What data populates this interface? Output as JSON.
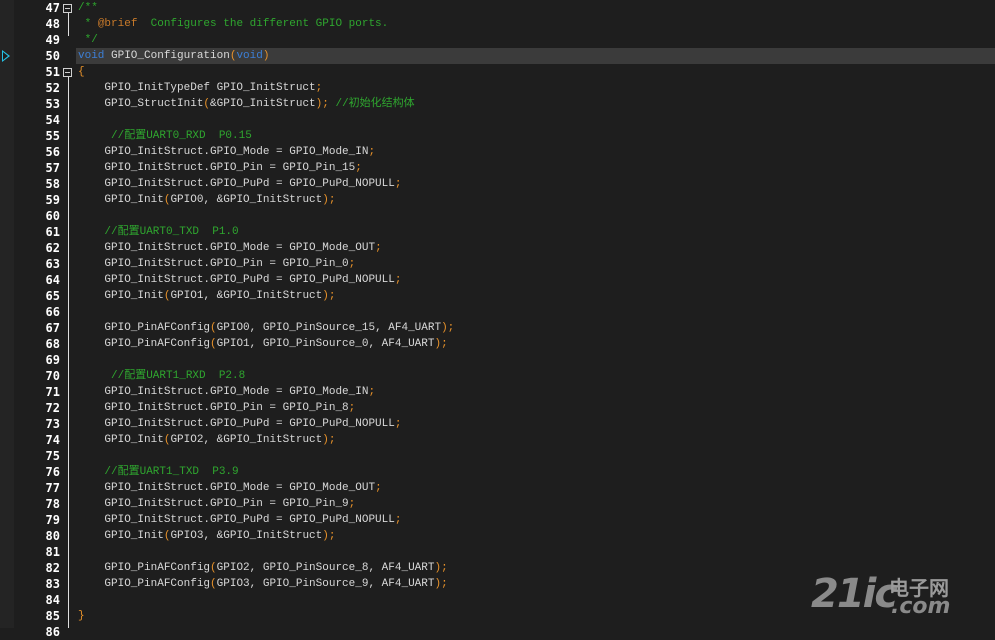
{
  "editor": {
    "current_line": "50",
    "lines": [
      {
        "n": "47",
        "tokens": [
          {
            "c": "t-doc",
            "t": "/**"
          }
        ],
        "fold": true
      },
      {
        "n": "48",
        "tokens": [
          {
            "c": "t-doc",
            "t": " * "
          },
          {
            "c": "t-tag",
            "t": "@brief"
          },
          {
            "c": "t-doc",
            "t": "  Configures the different GPIO ports."
          }
        ]
      },
      {
        "n": "49",
        "tokens": [
          {
            "c": "t-doc",
            "t": " */"
          }
        ]
      },
      {
        "n": "50",
        "tokens": [
          {
            "c": "t-kw",
            "t": "void"
          },
          {
            "c": "t-plain",
            "t": " GPIO_Configuration"
          },
          {
            "c": "t-brace",
            "t": "("
          },
          {
            "c": "t-kw",
            "t": "void"
          },
          {
            "c": "t-brace",
            "t": ")"
          }
        ],
        "current": true
      },
      {
        "n": "51",
        "tokens": [
          {
            "c": "t-brace",
            "t": "{"
          }
        ],
        "fold": true
      },
      {
        "n": "52",
        "tokens": [
          {
            "c": "t-plain",
            "t": "    GPIO_InitTypeDef GPIO_InitStruct"
          },
          {
            "c": "t-brace",
            "t": ";"
          }
        ]
      },
      {
        "n": "53",
        "tokens": [
          {
            "c": "t-plain",
            "t": "    GPIO_StructInit"
          },
          {
            "c": "t-brace",
            "t": "("
          },
          {
            "c": "t-plain",
            "t": "&GPIO_InitStruct"
          },
          {
            "c": "t-brace",
            "t": "); "
          },
          {
            "c": "t-comment",
            "t": "//初始化结构体"
          }
        ]
      },
      {
        "n": "54",
        "tokens": [
          {
            "c": "t-plain",
            "t": ""
          }
        ]
      },
      {
        "n": "55",
        "tokens": [
          {
            "c": "t-comment",
            "t": "     //配置UART0_RXD  P0.15"
          }
        ]
      },
      {
        "n": "56",
        "tokens": [
          {
            "c": "t-plain",
            "t": "    GPIO_InitStruct.GPIO_Mode = GPIO_Mode_IN"
          },
          {
            "c": "t-brace",
            "t": ";"
          }
        ]
      },
      {
        "n": "57",
        "tokens": [
          {
            "c": "t-plain",
            "t": "    GPIO_InitStruct.GPIO_Pin = GPIO_Pin_15"
          },
          {
            "c": "t-brace",
            "t": ";"
          }
        ]
      },
      {
        "n": "58",
        "tokens": [
          {
            "c": "t-plain",
            "t": "    GPIO_InitStruct.GPIO_PuPd = GPIO_PuPd_NOPULL"
          },
          {
            "c": "t-brace",
            "t": ";"
          }
        ]
      },
      {
        "n": "59",
        "tokens": [
          {
            "c": "t-plain",
            "t": "    GPIO_Init"
          },
          {
            "c": "t-brace",
            "t": "("
          },
          {
            "c": "t-plain",
            "t": "GPIO0, &GPIO_InitStruct"
          },
          {
            "c": "t-brace",
            "t": ");"
          }
        ]
      },
      {
        "n": "60",
        "tokens": [
          {
            "c": "t-plain",
            "t": ""
          }
        ]
      },
      {
        "n": "61",
        "tokens": [
          {
            "c": "t-comment",
            "t": "    //配置UART0_TXD  P1.0"
          }
        ]
      },
      {
        "n": "62",
        "tokens": [
          {
            "c": "t-plain",
            "t": "    GPIO_InitStruct.GPIO_Mode = GPIO_Mode_OUT"
          },
          {
            "c": "t-brace",
            "t": ";"
          }
        ]
      },
      {
        "n": "63",
        "tokens": [
          {
            "c": "t-plain",
            "t": "    GPIO_InitStruct.GPIO_Pin = GPIO_Pin_0"
          },
          {
            "c": "t-brace",
            "t": ";"
          }
        ]
      },
      {
        "n": "64",
        "tokens": [
          {
            "c": "t-plain",
            "t": "    GPIO_InitStruct.GPIO_PuPd = GPIO_PuPd_NOPULL"
          },
          {
            "c": "t-brace",
            "t": ";"
          }
        ]
      },
      {
        "n": "65",
        "tokens": [
          {
            "c": "t-plain",
            "t": "    GPIO_Init"
          },
          {
            "c": "t-brace",
            "t": "("
          },
          {
            "c": "t-plain",
            "t": "GPIO1, &GPIO_InitStruct"
          },
          {
            "c": "t-brace",
            "t": ");"
          }
        ]
      },
      {
        "n": "66",
        "tokens": [
          {
            "c": "t-plain",
            "t": ""
          }
        ]
      },
      {
        "n": "67",
        "tokens": [
          {
            "c": "t-plain",
            "t": "    GPIO_PinAFConfig"
          },
          {
            "c": "t-brace",
            "t": "("
          },
          {
            "c": "t-plain",
            "t": "GPIO0, GPIO_PinSource_15, AF4_UART"
          },
          {
            "c": "t-brace",
            "t": ");"
          }
        ]
      },
      {
        "n": "68",
        "tokens": [
          {
            "c": "t-plain",
            "t": "    GPIO_PinAFConfig"
          },
          {
            "c": "t-brace",
            "t": "("
          },
          {
            "c": "t-plain",
            "t": "GPIO1, GPIO_PinSource_0, AF4_UART"
          },
          {
            "c": "t-brace",
            "t": ");"
          }
        ]
      },
      {
        "n": "69",
        "tokens": [
          {
            "c": "t-plain",
            "t": ""
          }
        ]
      },
      {
        "n": "70",
        "tokens": [
          {
            "c": "t-comment",
            "t": "     //配置UART1_RXD  P2.8"
          }
        ]
      },
      {
        "n": "71",
        "tokens": [
          {
            "c": "t-plain",
            "t": "    GPIO_InitStruct.GPIO_Mode = GPIO_Mode_IN"
          },
          {
            "c": "t-brace",
            "t": ";"
          }
        ]
      },
      {
        "n": "72",
        "tokens": [
          {
            "c": "t-plain",
            "t": "    GPIO_InitStruct.GPIO_Pin = GPIO_Pin_8"
          },
          {
            "c": "t-brace",
            "t": ";"
          }
        ]
      },
      {
        "n": "73",
        "tokens": [
          {
            "c": "t-plain",
            "t": "    GPIO_InitStruct.GPIO_PuPd = GPIO_PuPd_NOPULL"
          },
          {
            "c": "t-brace",
            "t": ";"
          }
        ]
      },
      {
        "n": "74",
        "tokens": [
          {
            "c": "t-plain",
            "t": "    GPIO_Init"
          },
          {
            "c": "t-brace",
            "t": "("
          },
          {
            "c": "t-plain",
            "t": "GPIO2, &GPIO_InitStruct"
          },
          {
            "c": "t-brace",
            "t": ");"
          }
        ]
      },
      {
        "n": "75",
        "tokens": [
          {
            "c": "t-plain",
            "t": ""
          }
        ]
      },
      {
        "n": "76",
        "tokens": [
          {
            "c": "t-comment",
            "t": "    //配置UART1_TXD  P3.9"
          }
        ]
      },
      {
        "n": "77",
        "tokens": [
          {
            "c": "t-plain",
            "t": "    GPIO_InitStruct.GPIO_Mode = GPIO_Mode_OUT"
          },
          {
            "c": "t-brace",
            "t": ";"
          }
        ]
      },
      {
        "n": "78",
        "tokens": [
          {
            "c": "t-plain",
            "t": "    GPIO_InitStruct.GPIO_Pin = GPIO_Pin_9"
          },
          {
            "c": "t-brace",
            "t": ";"
          }
        ]
      },
      {
        "n": "79",
        "tokens": [
          {
            "c": "t-plain",
            "t": "    GPIO_InitStruct.GPIO_PuPd = GPIO_PuPd_NOPULL"
          },
          {
            "c": "t-brace",
            "t": ";"
          }
        ]
      },
      {
        "n": "80",
        "tokens": [
          {
            "c": "t-plain",
            "t": "    GPIO_Init"
          },
          {
            "c": "t-brace",
            "t": "("
          },
          {
            "c": "t-plain",
            "t": "GPIO3, &GPIO_InitStruct"
          },
          {
            "c": "t-brace",
            "t": ");"
          }
        ]
      },
      {
        "n": "81",
        "tokens": [
          {
            "c": "t-plain",
            "t": ""
          }
        ]
      },
      {
        "n": "82",
        "tokens": [
          {
            "c": "t-plain",
            "t": "    GPIO_PinAFConfig"
          },
          {
            "c": "t-brace",
            "t": "("
          },
          {
            "c": "t-plain",
            "t": "GPIO2, GPIO_PinSource_8, AF4_UART"
          },
          {
            "c": "t-brace",
            "t": ");"
          }
        ]
      },
      {
        "n": "83",
        "tokens": [
          {
            "c": "t-plain",
            "t": "    GPIO_PinAFConfig"
          },
          {
            "c": "t-brace",
            "t": "("
          },
          {
            "c": "t-plain",
            "t": "GPIO3, GPIO_PinSource_9, AF4_UART"
          },
          {
            "c": "t-brace",
            "t": ");"
          }
        ]
      },
      {
        "n": "84",
        "tokens": [
          {
            "c": "t-plain",
            "t": ""
          }
        ]
      },
      {
        "n": "85",
        "tokens": [
          {
            "c": "t-brace",
            "t": "}"
          }
        ]
      },
      {
        "n": "86",
        "tokens": [
          {
            "c": "t-plain",
            "t": ""
          }
        ]
      }
    ]
  },
  "colors": {
    "background": "#1e1e1e",
    "comment": "#2fa62f",
    "keyword": "#3c7fd6",
    "punctuation": "#e8922a",
    "line_number": "#ffffff",
    "current_line_bg": "#3b3b3b",
    "breakpoint_arrow": "#25c2e6"
  },
  "icons": {
    "current_line_marker": "current-line-arrow-icon",
    "fold_toggle": "fold-collapse-icon"
  },
  "watermark": {
    "main": "21ic",
    "cn": "电子网",
    "com": ".com"
  }
}
